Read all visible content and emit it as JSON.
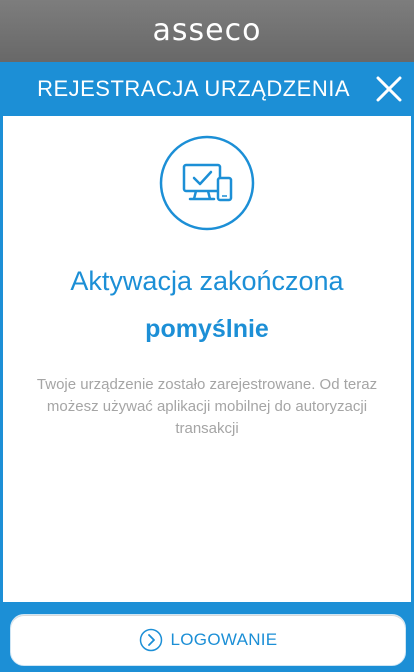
{
  "brand": {
    "logo_text": "asseco"
  },
  "header": {
    "title": "REJESTRACJA URZĄDZENIA",
    "close_icon": "close-icon"
  },
  "main": {
    "icon": "device-check-icon",
    "headline_line1": "Aktywacja zakończona",
    "headline_line2": "pomyślnie",
    "message": "Twoje urządzenie zostało zarejestrowane. Od teraz możesz używać aplikacji mobilnej do autoryzacji transakcji"
  },
  "footer": {
    "login_label": "LOGOWANIE",
    "login_icon": "chevron-right-circle-icon"
  },
  "colors": {
    "accent": "#1c8fd6",
    "brand_bar": "#707070",
    "message_text": "#a5a5a5"
  }
}
